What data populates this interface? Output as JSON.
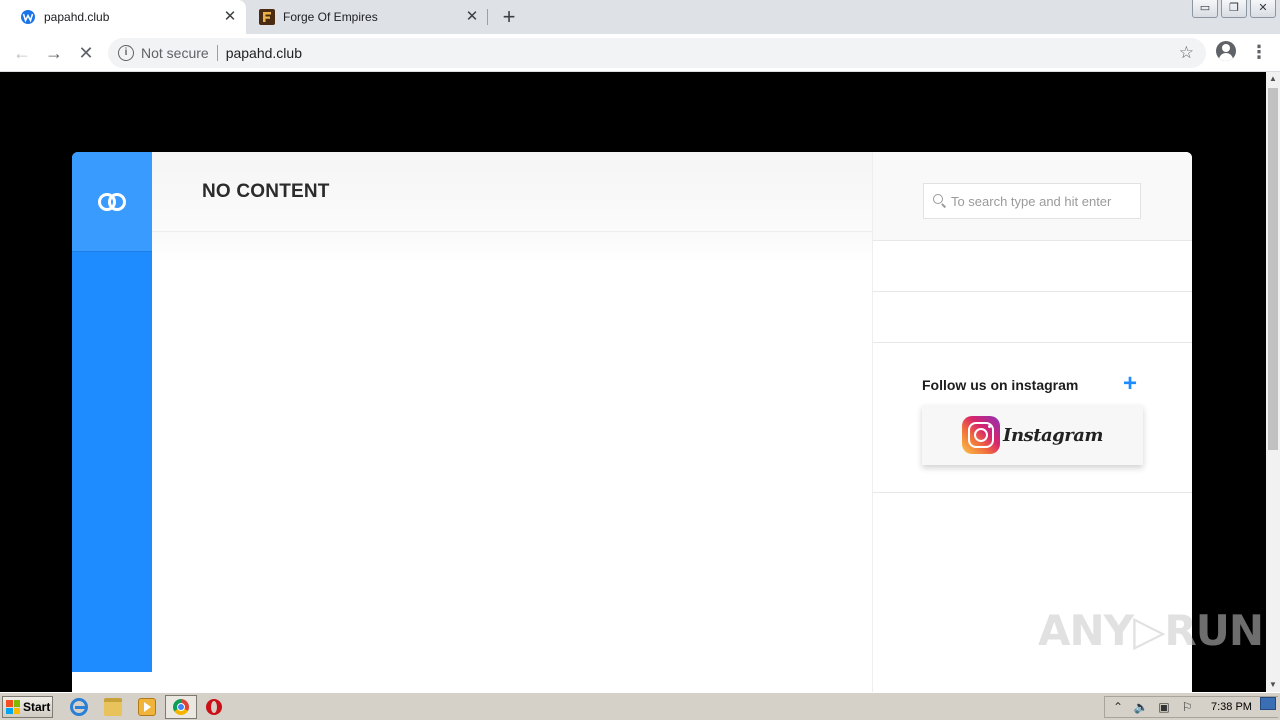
{
  "browser": {
    "tabs": [
      {
        "title": "papahd.club",
        "icon": "globe-icon",
        "active": true
      },
      {
        "title": "Forge Of Empires",
        "icon": "forge-of-empires-favicon",
        "active": false
      }
    ],
    "new_tab_symbol": "+",
    "close_symbol": "✕",
    "window_buttons": {
      "minimize": "▭",
      "restore": "❐",
      "close": "✕"
    },
    "nav": {
      "back": "←",
      "forward": "→",
      "stop": "✕"
    },
    "omnibox": {
      "security_label": "Not secure",
      "url": "papahd.club",
      "info_symbol": "i",
      "star": "☆"
    },
    "menu_symbol": "⋮"
  },
  "page": {
    "heading": "NO CONTENT",
    "search": {
      "placeholder": "To search type and hit enter"
    },
    "instagram": {
      "title": "Follow us on instagram",
      "plus": "+",
      "wordmark": "Instagram"
    },
    "brand_color": "#1e8cff"
  },
  "scrollbar": {
    "up": "▲",
    "down": "▼"
  },
  "watermark": "ANY▷RUN",
  "taskbar": {
    "start_label": "Start",
    "tray_symbols": [
      "⌃",
      "🔈",
      "▣",
      "⚐"
    ],
    "clock": "7:38 PM"
  }
}
